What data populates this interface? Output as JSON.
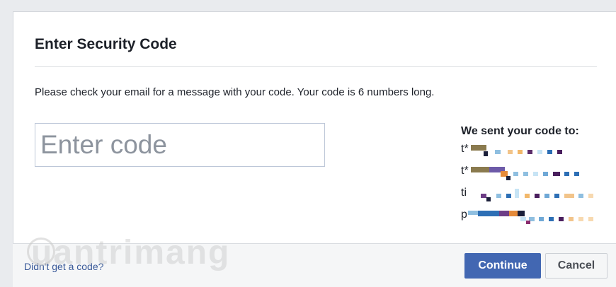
{
  "dialog": {
    "title": "Enter Security Code",
    "instructions": "Please check your email for a message with your code. Your code is 6 numbers long.",
    "code_input": {
      "placeholder": "Enter code",
      "value": ""
    },
    "sent_title": "We sent your code to:",
    "recipients": [
      {
        "prefix": "t*"
      },
      {
        "prefix": "t*"
      },
      {
        "prefix": "ti"
      },
      {
        "prefix": "p"
      }
    ]
  },
  "footer": {
    "no_code_link": "Didn't get a code?",
    "continue_label": "Continue",
    "cancel_label": "Cancel"
  },
  "watermark": {
    "text": "uantrimang"
  },
  "colors": {
    "primary": "#4267b2",
    "link": "#385898",
    "text": "#1d2129"
  }
}
